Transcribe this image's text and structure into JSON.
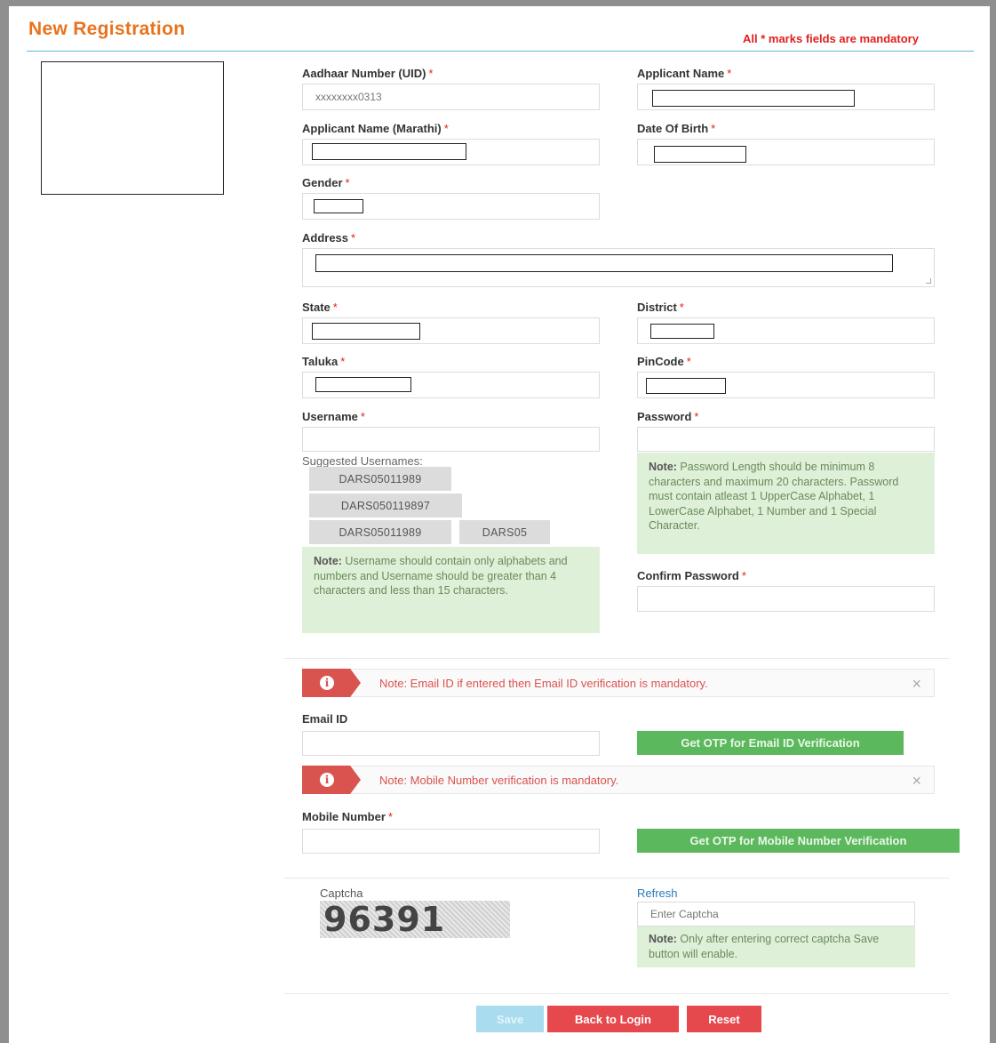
{
  "header": {
    "title": "New Registration",
    "mandatory_note": "All * marks fields are mandatory"
  },
  "labels": {
    "aadhaar": "Aadhaar Number (UID)",
    "applicant_name": "Applicant Name",
    "applicant_name_marathi": "Applicant Name (Marathi)",
    "dob": "Date Of Birth",
    "gender": "Gender",
    "address": "Address",
    "state": "State",
    "district": "District",
    "taluka": "Taluka",
    "pincode": "PinCode",
    "username": "Username",
    "password": "Password",
    "confirm_password": "Confirm Password",
    "email": "Email ID",
    "mobile": "Mobile Number",
    "required_mark": "*"
  },
  "values": {
    "aadhaar": "xxxxxxxx0313"
  },
  "suggested": {
    "label": "Suggested Usernames:",
    "items": [
      "DARS05011989",
      "DARS050119897",
      "DARS05011989",
      "DARS05"
    ]
  },
  "notes": {
    "username_bold": "Note:",
    "username_text": " Username should contain only alphabets and numbers and Username should be greater than 4 characters and less than 15 characters.",
    "password_bold": "Note:",
    "password_text": " Password Length should be minimum 8 characters and maximum 20 characters. Password must contain atleast 1 UpperCase Alphabet, 1 LowerCase Alphabet, 1 Number and 1 Special Character.",
    "captcha_bold": "Note:",
    "captcha_text": " Only after entering correct captcha Save button will enable."
  },
  "alerts": {
    "email": "Note: Email ID if entered then Email ID verification is mandatory.",
    "mobile": "Note: Mobile Number verification is mandatory.",
    "close_glyph": "×"
  },
  "buttons": {
    "email_otp": "Get OTP for Email ID Verification",
    "mobile_otp": "Get OTP for Mobile Number Verification",
    "save": "Save",
    "back": "Back to Login",
    "reset": "Reset"
  },
  "captcha": {
    "label": "Captcha",
    "code": "96391",
    "refresh": "Refresh",
    "placeholder": "Enter Captcha"
  },
  "colors": {
    "title": "#e8731c",
    "required": "#e01f1f",
    "otp_button": "#5cb85c",
    "save_button_disabled": "#a9dcef",
    "back_button": "#e5484d",
    "note_bg": "#dff0d8",
    "alert": "#d9534f"
  }
}
